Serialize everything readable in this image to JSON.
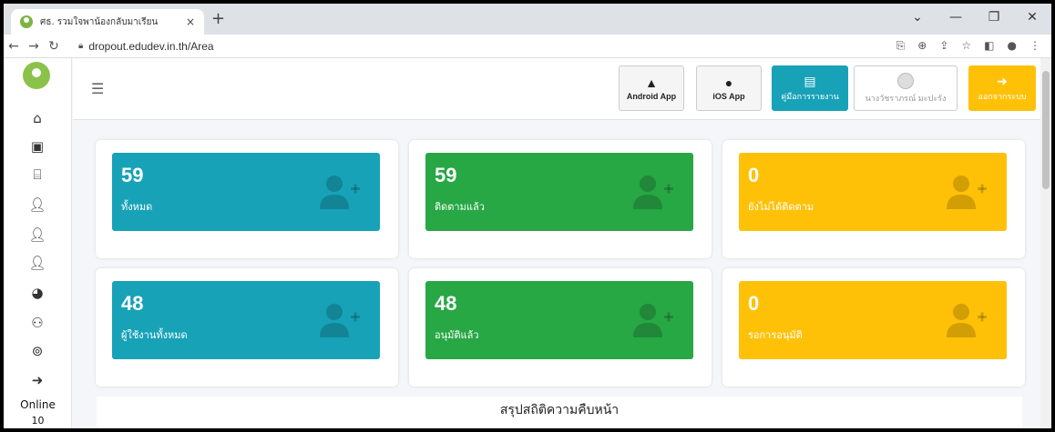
{
  "browser": {
    "tab_title": "ศธ. รวมใจพาน้องกลับมาเรียน",
    "tab_close": "×",
    "new_tab": "+",
    "url": "dropout.edudev.in.th/Area",
    "controls": {
      "chevron": "⌄",
      "minimize": "—",
      "restore": "❐",
      "close": "✕"
    }
  },
  "sidebar": {
    "online_label": "Online",
    "online_count": "10"
  },
  "topbar": {
    "android_label": "Android App",
    "ios_label": "iOS App",
    "manual_label": "คู่มือการรายงาน",
    "user_label": "นางวัชราภรณ์ มะปะรัง",
    "logout_label": "ออกจากระบบ"
  },
  "stats": [
    {
      "value": "59",
      "label": "ทั้งหมด",
      "color": "#17a2b8"
    },
    {
      "value": "59",
      "label": "ติดตามแล้ว",
      "color": "#28a745"
    },
    {
      "value": "0",
      "label": "ยังไม่ได้ติดตาม",
      "color": "#ffc107"
    },
    {
      "value": "48",
      "label": "ผู้ใช้งานทั้งหมด",
      "color": "#17a2b8"
    },
    {
      "value": "48",
      "label": "อนุมัติแล้ว",
      "color": "#28a745"
    },
    {
      "value": "0",
      "label": "รอการอนุมัติ",
      "color": "#ffc107"
    }
  ],
  "summary": {
    "title": "สรุปสถิติความคืบหน้า"
  }
}
